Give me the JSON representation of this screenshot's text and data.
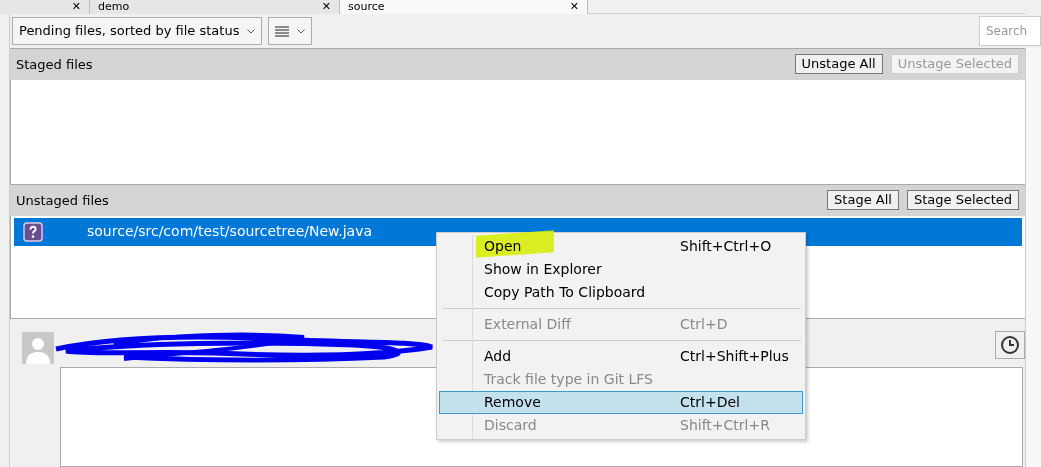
{
  "tabs": [
    {
      "close": "✕",
      "selected": false
    },
    {
      "label": "demo",
      "close": "✕",
      "selected": false
    },
    {
      "label": "source",
      "close": "✕",
      "selected": true
    }
  ],
  "toolbar": {
    "view_dropdown": "Pending files, sorted by file status",
    "search": {
      "placeholder": "Search"
    }
  },
  "staged": {
    "title": "Staged files",
    "buttons": [
      {
        "label": "Unstage All",
        "disabled": false
      },
      {
        "label": "Unstage Selected",
        "disabled": true
      }
    ]
  },
  "unstaged": {
    "title": "Unstaged files",
    "buttons": [
      {
        "label": "Stage All",
        "disabled": false
      },
      {
        "label": "Stage Selected",
        "disabled": false
      }
    ],
    "files": [
      {
        "path": "source/src/com/test/sourcetree/New.java",
        "kind": "untracked",
        "selected": true
      }
    ]
  },
  "context_menu": [
    {
      "kind": "item",
      "label": "Open",
      "shortcut": "Shift+Ctrl+O",
      "disabled": false,
      "selected": false
    },
    {
      "kind": "item",
      "label": "Show in Explorer",
      "disabled": false,
      "selected": false
    },
    {
      "kind": "item",
      "label": "Copy Path To Clipboard",
      "disabled": false,
      "selected": false
    },
    {
      "kind": "separator"
    },
    {
      "kind": "item",
      "label": "External Diff",
      "shortcut": "Ctrl+D",
      "disabled": true,
      "selected": false
    },
    {
      "kind": "separator"
    },
    {
      "kind": "item",
      "label": "Add",
      "shortcut": "Ctrl+Shift+Plus",
      "disabled": false,
      "selected": false
    },
    {
      "kind": "item",
      "label": "Track file type in Git LFS",
      "disabled": true,
      "selected": false
    },
    {
      "kind": "item",
      "label": "Remove",
      "shortcut": "Ctrl+Del",
      "disabled": false,
      "selected": true
    },
    {
      "kind": "item",
      "label": "Discard",
      "shortcut": "Shift+Ctrl+R",
      "disabled": true,
      "selected": false
    }
  ]
}
